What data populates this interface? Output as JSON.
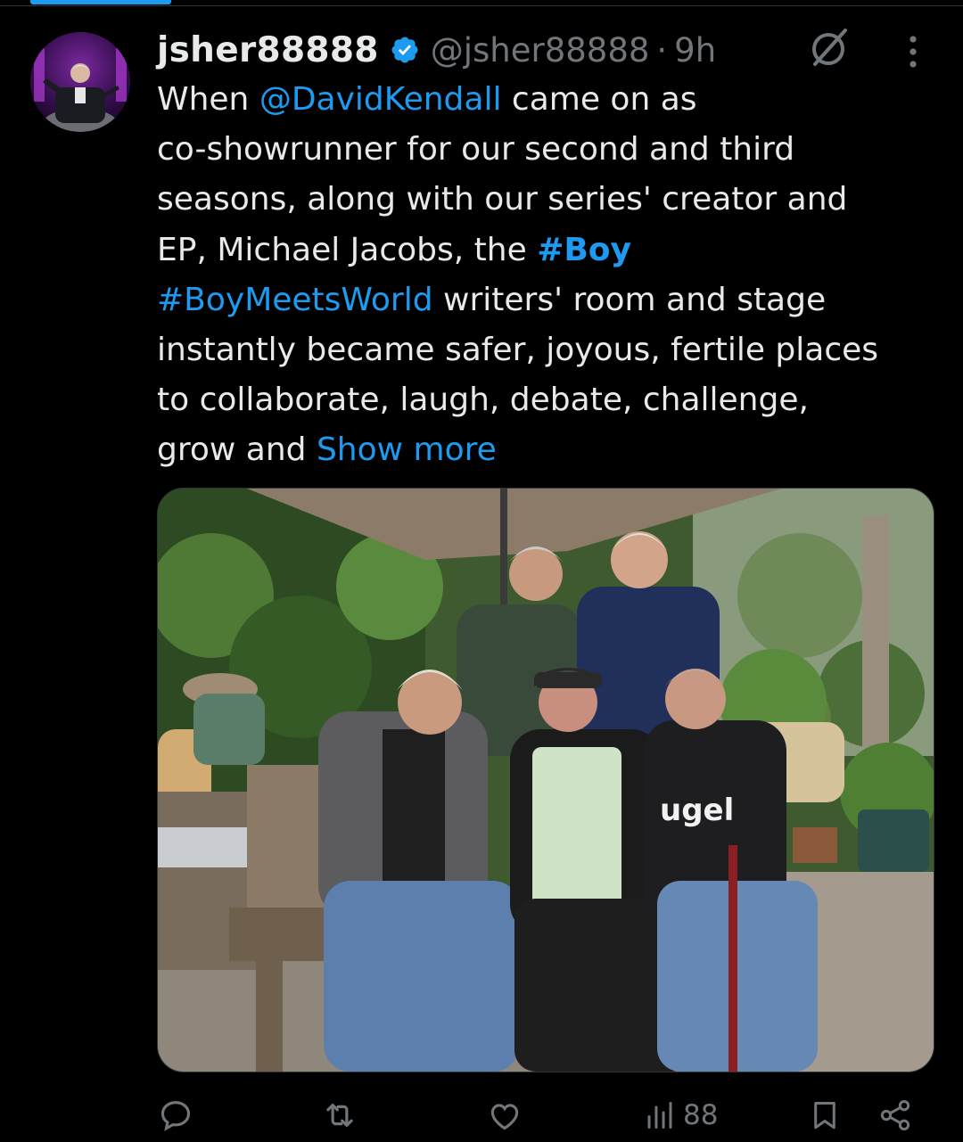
{
  "tweet": {
    "display_name": "jsher88888",
    "handle": "@jsher88888",
    "separator": "·",
    "time": "9h",
    "text_lines": [
      [
        {
          "t": "When ",
          "k": "text"
        },
        {
          "t": "@DavidKendall",
          "k": "mention"
        },
        {
          "t": " came on as",
          "k": "text"
        }
      ],
      [
        {
          "t": "co-showrunner for our second and third",
          "k": "text"
        }
      ],
      [
        {
          "t": "seasons, along with our series' creator and",
          "k": "text"
        }
      ],
      [
        {
          "t": "EP, Michael Jacobs, the ",
          "k": "text"
        },
        {
          "t": "#Boy",
          "k": "hashtag"
        }
      ],
      [
        {
          "t": "#BoyMeetsWorld",
          "k": "hashtag-link"
        },
        {
          "t": " writers' room and stage",
          "k": "text"
        }
      ],
      [
        {
          "t": "instantly became safer, joyous, fertile  places",
          "k": "text"
        }
      ],
      [
        {
          "t": "to collaborate, laugh, debate, challenge,",
          "k": "text"
        }
      ],
      [
        {
          "t": "grow and ",
          "k": "text"
        },
        {
          "t": "Show more",
          "k": "show-more"
        }
      ]
    ],
    "media_shirt_text": "ugel"
  },
  "actions": {
    "reply_icon": "reply-icon",
    "repost_icon": "repost-icon",
    "like_icon": "like-icon",
    "views_icon": "views-icon",
    "views_count": "88",
    "bookmark_icon": "bookmark-icon",
    "share_icon": "share-icon"
  },
  "colors": {
    "background": "#000000",
    "text": "#e7e9ea",
    "muted": "#71767b",
    "accent": "#1d9bf0"
  }
}
